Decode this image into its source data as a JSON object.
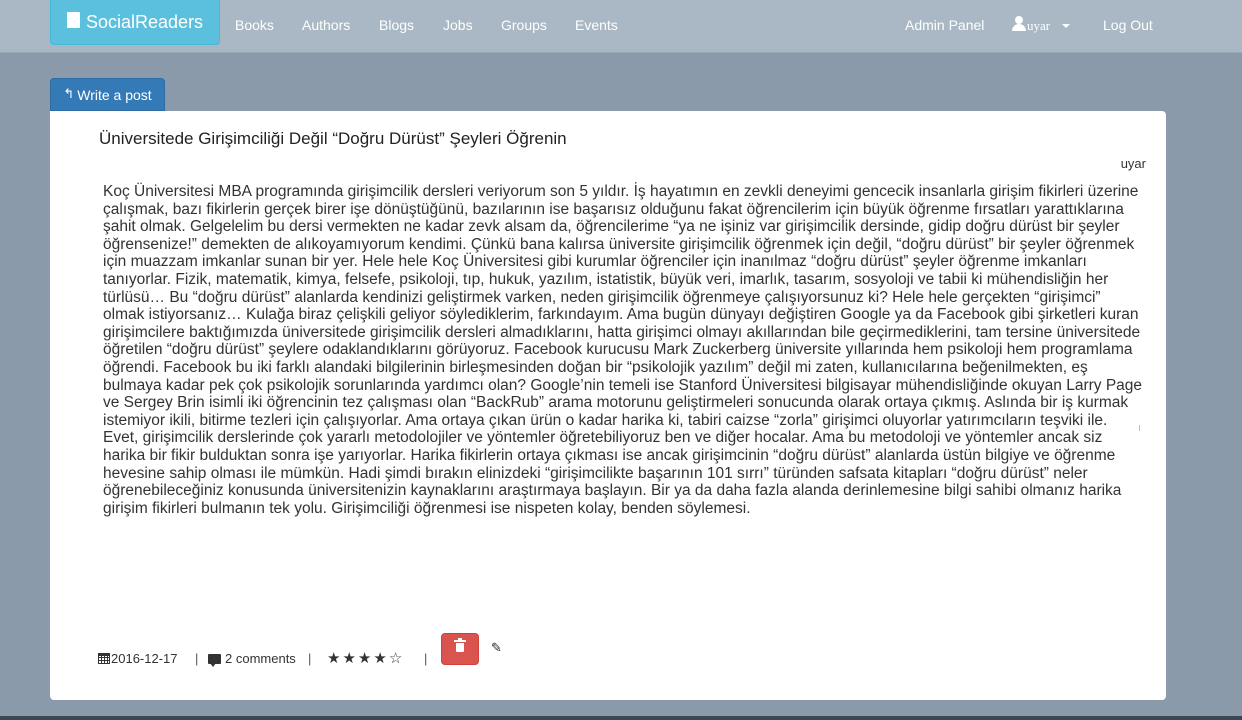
{
  "navbar": {
    "brand": "SocialReaders",
    "links": [
      "Books",
      "Authors",
      "Blogs",
      "Jobs",
      "Groups",
      "Events"
    ],
    "admin": "Admin Panel",
    "user": "uyar",
    "logout": "Log Out"
  },
  "write_post": {
    "icon": "reply-icon",
    "label": "Write a post"
  },
  "post": {
    "title": "Üniversitede Girişimciliği Değil “Doğru Dürüst” Şeyleri Öğrenin",
    "author": "uyar",
    "body": "Koç Üniversitesi MBA programında girişimcilik dersleri veriyorum son 5 yıldır. İş hayatımın en zevkli deneyimi gencecik insanlarla girişim fikirleri üzerine çalışmak, bazı fikirlerin gerçek birer işe dönüştüğünü, bazılarının ise başarısız olduğunu fakat öğrencilerim için büyük öğrenme fırsatları yarattıklarına şahit olmak. Gelgelelim bu dersi vermekten ne kadar zevk alsam da, öğrencilerime “ya ne işiniz var girişimcilik dersinde, gidip doğru dürüst bir şeyler öğrensenize!” demekten de alıkoyamıyorum kendimi. Çünkü bana kalırsa üniversite girişimcilik öğrenmek için değil, “doğru dürüst” bir şeyler öğrenmek için muazzam imkanlar sunan bir yer. Hele hele Koç Üniversitesi gibi kurumlar öğrenciler için inanılmaz “doğru dürüst” şeyler öğrenme imkanları tanıyorlar. Fizik, matematik, kimya, felsefe, psikoloji, tıp, hukuk, yazılım, istatistik, büyük veri, imarlık, tasarım, sosyoloji ve tabii ki mühendisliğin her türlüsü… Bu “doğru dürüst” alanlarda kendinizi geliştirmek varken, neden girişimcilik öğrenmeye çalışıyorsunuz ki? Hele hele gerçekten “girişimci” olmak istiyorsanız… Kulağa biraz çelişkili geliyor söylediklerim, farkındayım. Ama bugün dünyayı değiştiren Google ya da Facebook gibi şirketleri kuran girişimcilere baktığımızda üniversitede girişimcilik dersleri almadıklarını, hatta girişimci olmayı akıllarından bile geçirmediklerini, tam tersine üniversitede öğretilen “doğru dürüst” şeylere odaklandıklarını görüyoruz. Facebook kurucusu Mark Zuckerberg üniversite yıllarında hem psikoloji hem programlama öğrendi. Facebook bu iki farklı alandaki bilgilerinin birleşmesinden doğan bir “psikolojik yazılım” değil mi zaten, kullanıcılarına beğenilmekten, eş bulmaya kadar pek çok psikolojik sorunlarında yardımcı olan? Google’nin temeli ise Stanford Üniversitesi bilgisayar mühendisliğinde okuyan Larry Page ve Sergey Brin isimli iki öğrencinin tez çalışması olan “BackRub” arama motorunu geliştirmeleri sonucunda olarak ortaya çıkmış. Aslında bir iş kurmak istemiyor ikili, bitirme tezleri için çalışıyorlar. Ama ortaya çıkan ürün o kadar harika ki, tabiri caizse “zorla” girişimci oluyorlar yatırımcıların teşviki ile. Evet, girişimcilik derslerinde çok yararlı metodolojiler ve yöntemler öğretebiliyoruz ben ve diğer hocalar. Ama bu metodoloji ve yöntemler ancak siz harika bir fikir bulduktan sonra işe yarıyorlar. Harika fikirlerin ortaya çıkması ise ancak girişimcinin “doğru dürüst” alanlarda üstün bilgiye ve öğrenme hevesine sahip olması ile mümkün. Hadi şimdi bırakın elinizdeki “girişimcilikte başarının 101 sırrı” türünden safsata kitapları “doğru dürüst” neler öğrenebileceğiniz konusunda üniversitenizin kaynaklarını araştırmaya başlayın. Bir ya da daha fazla alanda derinlemesine bilgi sahibi olmanız harika girişim fikirleri bulmanın tek yolu. Girişimciliği öğrenmesi ise nispeten kolay, benden söylemesi.",
    "date": "2016-12-17",
    "comments": "2 comments",
    "separator": "|",
    "rating": 4,
    "rating_max": 5,
    "stars": [
      "★",
      "★",
      "★",
      "★",
      "☆"
    ],
    "edit_glyph": "✎"
  }
}
